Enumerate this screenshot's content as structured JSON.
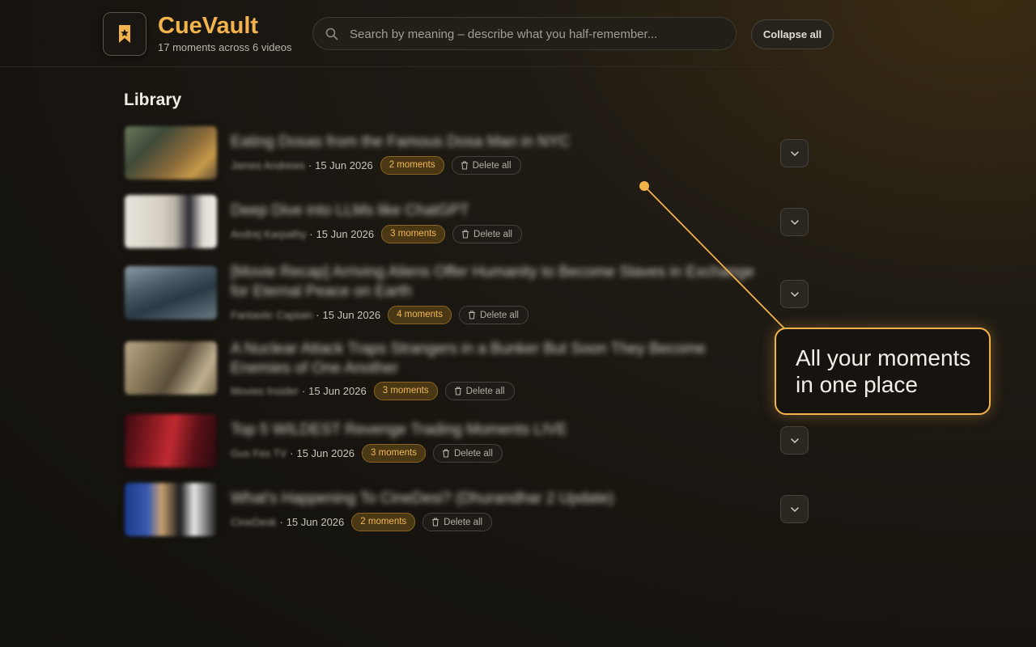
{
  "header": {
    "app_name": "CueVault",
    "subtitle": "17 moments across 6 videos",
    "logo_icon": "bookmark-icon",
    "search_placeholder": "Search by meaning – describe what you half-remember...",
    "search_value": "",
    "collapse_label": "Collapse all"
  },
  "library": {
    "title": "Library",
    "videos": [
      {
        "title": "Eating Dosas from the Famous Dosa Man in NYC",
        "channel": "James Andrews",
        "date": "15 Jun 2026",
        "moments": "2 moments",
        "delete_label": "Delete all"
      },
      {
        "title": "Deep Dive into LLMs like ChatGPT",
        "channel": "Andrej Karpathy",
        "date": "15 Jun 2026",
        "moments": "3 moments",
        "delete_label": "Delete all"
      },
      {
        "title": "[Movie Recap] Arriving Aliens Offer Humanity to Become Slaves in Exchange for Eternal Peace on Earth",
        "channel": "Fantastic Captain",
        "date": "15 Jun 2026",
        "moments": "4 moments",
        "delete_label": "Delete all"
      },
      {
        "title": "A Nuclear Attack Traps Strangers in a Bunker But Soon They Become Enemies of One Another",
        "channel": "Movies Insider",
        "date": "15 Jun 2026",
        "moments": "3 moments",
        "delete_label": "Delete all"
      },
      {
        "title": "Top 5 WILDEST Revenge Trading Moments LIVE",
        "channel": "Gus Fes TV",
        "date": "15 Jun 2026",
        "moments": "3 moments",
        "delete_label": "Delete all"
      },
      {
        "title": "What's Happening To CineDesi? (Dhurandhar 2 Update)",
        "channel": "CineDesk",
        "date": "15 Jun 2026",
        "moments": "2 moments",
        "delete_label": "Delete all"
      }
    ]
  },
  "callout": {
    "text": "All your moments in one place"
  },
  "colors": {
    "accent": "#f2b24c",
    "background": "#17140f"
  }
}
